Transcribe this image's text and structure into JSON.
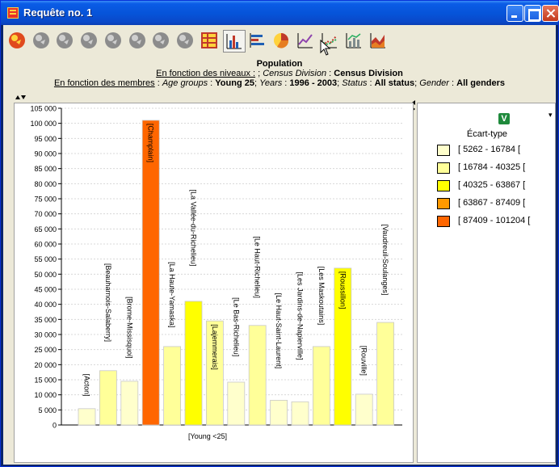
{
  "window": {
    "title": "Requête no. 1"
  },
  "toolbar": {
    "tools": [
      {
        "icon": "globe-color-icon",
        "style": "color",
        "pressed": false
      },
      {
        "icon": "globe-gray-icon",
        "style": "gray",
        "pressed": false
      },
      {
        "icon": "globe-gray-icon",
        "style": "gray",
        "pressed": false
      },
      {
        "icon": "globe-gray-icon",
        "style": "gray",
        "pressed": false
      },
      {
        "icon": "globe-gray-icon",
        "style": "gray",
        "pressed": false
      },
      {
        "icon": "globe-gray-icon",
        "style": "gray",
        "pressed": false
      },
      {
        "icon": "globe-gray-icon",
        "style": "gray",
        "pressed": false
      },
      {
        "icon": "globe-gray-icon",
        "style": "gray",
        "pressed": false
      },
      {
        "icon": "table-icon",
        "style": "table",
        "pressed": false
      },
      {
        "icon": "bar-chart-icon",
        "style": "bar",
        "pressed": true
      },
      {
        "icon": "horizontal-bar-chart-icon",
        "style": "hbar",
        "pressed": false
      },
      {
        "icon": "pie-chart-icon",
        "style": "pie",
        "pressed": false
      },
      {
        "icon": "line-chart-icon",
        "style": "line",
        "pressed": false
      },
      {
        "icon": "scatter-chart-icon",
        "style": "scatter",
        "pressed": false
      },
      {
        "icon": "column-line-chart-icon",
        "style": "colline",
        "pressed": false
      },
      {
        "icon": "area-chart-icon",
        "style": "area",
        "pressed": false
      }
    ]
  },
  "header": {
    "title": "Population",
    "levels_prefix": "En fonction des niveaux :",
    "levels_sep": " ; ",
    "levels_key": "Census Division",
    "levels_value": "Census Division",
    "members_prefix": "En fonction des membres",
    "members": [
      {
        "key": "Age groups",
        "value": "Young 25"
      },
      {
        "key": "Years",
        "value": "1996 - 2003"
      },
      {
        "key": "Status",
        "value": "All status"
      },
      {
        "key": "Gender",
        "value": "All genders"
      }
    ]
  },
  "legend": {
    "badge": "V",
    "title": "Écart-type",
    "items": [
      {
        "label": "[ 5262 - 16784 [",
        "color": "#ffffcc"
      },
      {
        "label": "[ 16784 - 40325 [",
        "color": "#ffff99"
      },
      {
        "label": "[ 40325 - 63867 [",
        "color": "#ffff00"
      },
      {
        "label": "[ 63867 - 87409 [",
        "color": "#ff9900"
      },
      {
        "label": "[ 87409 - 101204 [",
        "color": "#ff6600"
      }
    ]
  },
  "chart_data": {
    "type": "bar",
    "xlabel": "[Young <25]",
    "ylim": [
      0,
      105000
    ],
    "yticks": [
      "0",
      "5 000",
      "10 000",
      "15 000",
      "20 000",
      "25 000",
      "30 000",
      "35 000",
      "40 000",
      "45 000",
      "50 000",
      "55 000",
      "60 000",
      "65 000",
      "70 000",
      "75 000",
      "80 000",
      "85 000",
      "90 000",
      "95 000",
      "100 000",
      "105 000"
    ],
    "grid": true,
    "categories": [
      "[Acton]",
      "[Beauharnois-Salaberry]",
      "[Brome-Missisquoi]",
      "[Champlain]",
      "[La Haute-Yamaska]",
      "[La Vallée-du-Richelieu]",
      "[Lajemmerais]",
      "[Le Bas-Richelieu]",
      "[Le Haut-Richelieu]",
      "[Le Haut-Saint-Laurent]",
      "[Les Jardins-de-Napierville]",
      "[Les Maskoutains]",
      "[Roussillon]",
      "[Rouville]",
      "[Vaudreuil-Soulanges]"
    ],
    "values": [
      5400,
      18000,
      14500,
      101000,
      26000,
      41000,
      34500,
      14200,
      33000,
      8200,
      7700,
      26000,
      52000,
      10200,
      34000
    ],
    "colors": [
      "#ffffcc",
      "#ffff99",
      "#ffffcc",
      "#ff6600",
      "#ffff99",
      "#ffff00",
      "#ffff99",
      "#ffffcc",
      "#ffff99",
      "#ffffcc",
      "#ffffcc",
      "#ffff99",
      "#ffff00",
      "#ffffcc",
      "#ffff99"
    ]
  }
}
